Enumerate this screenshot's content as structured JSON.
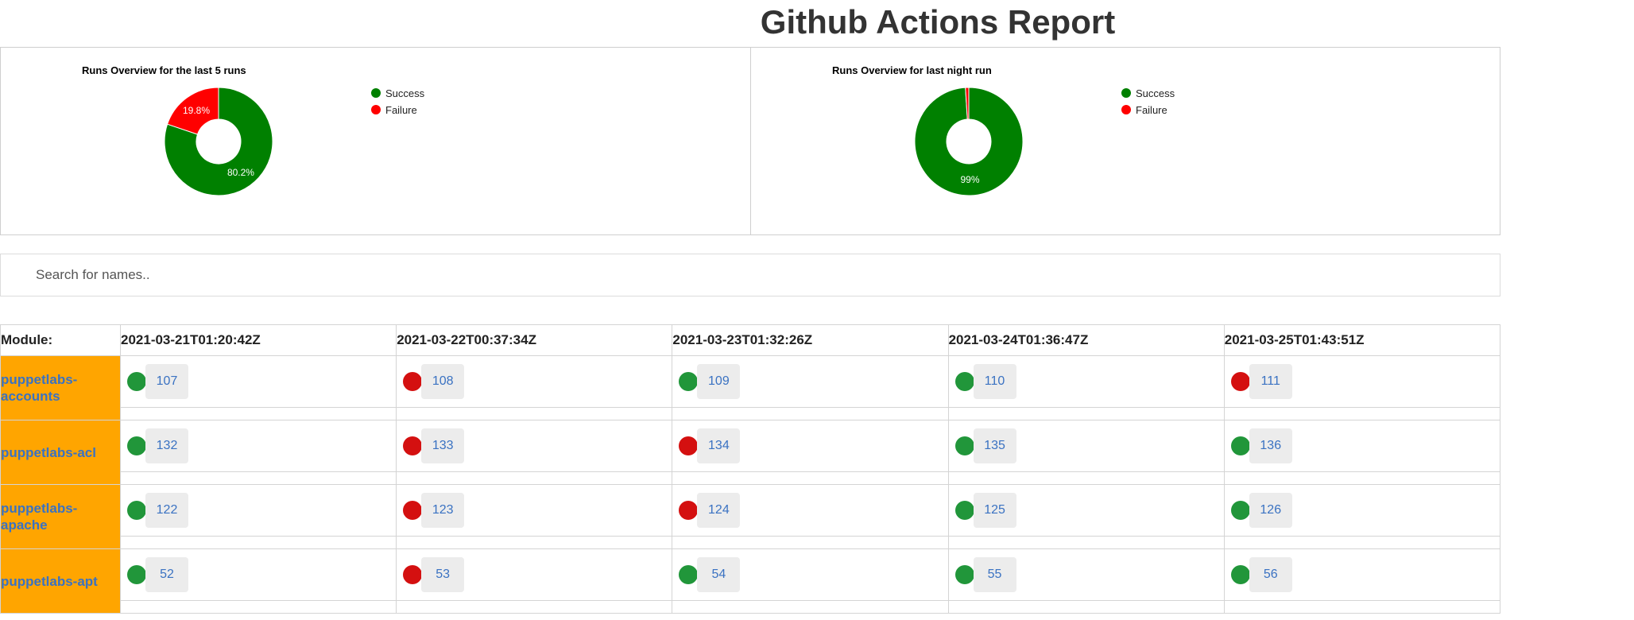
{
  "page": {
    "title": "Github Actions Report"
  },
  "colors": {
    "success": "#008000",
    "failure": "#ff0000",
    "module_bg": "#ffa500",
    "link": "#3a72c2"
  },
  "chart_data": [
    {
      "type": "pie",
      "title": "Runs Overview for the last 5 runs",
      "labels": [
        "Success",
        "Failure"
      ],
      "values": [
        80.2,
        19.8
      ],
      "value_labels": [
        "80.2%",
        "19.8%"
      ],
      "colors": [
        "#008000",
        "#ff0000"
      ],
      "legend_position": "right"
    },
    {
      "type": "pie",
      "title": "Runs Overview for last night run",
      "labels": [
        "Success",
        "Failure"
      ],
      "values": [
        99,
        1
      ],
      "value_labels": [
        "99%",
        ""
      ],
      "colors": [
        "#008000",
        "#ff0000"
      ],
      "legend_position": "right"
    }
  ],
  "search": {
    "placeholder": "Search for names.."
  },
  "table": {
    "module_header": "Module:",
    "dates": [
      "2021-03-21T01:20:42Z",
      "2021-03-22T00:37:34Z",
      "2021-03-23T01:32:26Z",
      "2021-03-24T01:36:47Z",
      "2021-03-25T01:43:51Z"
    ],
    "rows": [
      {
        "module": "puppetlabs-accounts",
        "runs": [
          {
            "status": "success",
            "id": "107"
          },
          {
            "status": "failure",
            "id": "108"
          },
          {
            "status": "success",
            "id": "109"
          },
          {
            "status": "success",
            "id": "110"
          },
          {
            "status": "failure",
            "id": "111"
          }
        ]
      },
      {
        "module": "puppetlabs-acl",
        "runs": [
          {
            "status": "success",
            "id": "132"
          },
          {
            "status": "failure",
            "id": "133"
          },
          {
            "status": "failure",
            "id": "134"
          },
          {
            "status": "success",
            "id": "135"
          },
          {
            "status": "success",
            "id": "136"
          }
        ]
      },
      {
        "module": "puppetlabs-apache",
        "runs": [
          {
            "status": "success",
            "id": "122"
          },
          {
            "status": "failure",
            "id": "123"
          },
          {
            "status": "failure",
            "id": "124"
          },
          {
            "status": "success",
            "id": "125"
          },
          {
            "status": "success",
            "id": "126"
          }
        ]
      },
      {
        "module": "puppetlabs-apt",
        "runs": [
          {
            "status": "success",
            "id": "52"
          },
          {
            "status": "failure",
            "id": "53"
          },
          {
            "status": "success",
            "id": "54"
          },
          {
            "status": "success",
            "id": "55"
          },
          {
            "status": "success",
            "id": "56"
          }
        ]
      }
    ]
  }
}
